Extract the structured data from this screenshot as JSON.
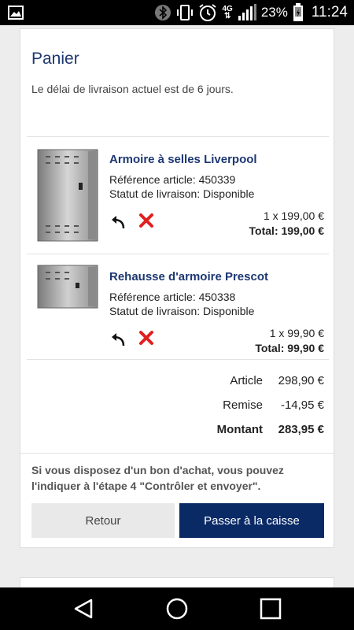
{
  "status_bar": {
    "network": "4G",
    "battery": "23%",
    "time": "11:24"
  },
  "cart": {
    "title": "Panier",
    "delivery_text": "Le délai de livraison actuel est de 6 jours.",
    "items": [
      {
        "name": "Armoire à selles Liverpool",
        "reference": "Référence article: 450339",
        "status": "Statut de livraison: Disponible",
        "quantity_price": "1 x 199,00 €",
        "total": "Total: 199,00 €"
      },
      {
        "name": "Rehausse d'armoire Prescot",
        "reference": "Référence article: 450338",
        "status": "Statut de livraison: Disponible",
        "quantity_price": "1 x 99,90 €",
        "total": "Total: 99,90 €"
      }
    ],
    "summary": {
      "article_label": "Article",
      "article_value": "298,90 €",
      "discount_label": "Remise",
      "discount_value": "-14,95 €",
      "amount_label": "Montant",
      "amount_value": "283,95 €"
    },
    "voucher_text": "Si vous disposez d'un bon d'achat, vous pouvez l'indiquer à l'étape 4 \"Contrôler et envoyer\".",
    "back_label": "Retour",
    "checkout_label": "Passer à la caisse"
  },
  "colors": {
    "accent": "#1c3772",
    "checkout_button": "#0a2a66",
    "delete_icon": "#e02020"
  },
  "icons": [
    "image-icon",
    "bluetooth-icon",
    "vibrate-icon",
    "alarm-icon",
    "signal-icon",
    "battery-icon",
    "undo-icon",
    "delete-icon",
    "back-nav-icon",
    "home-nav-icon",
    "recents-nav-icon"
  ]
}
